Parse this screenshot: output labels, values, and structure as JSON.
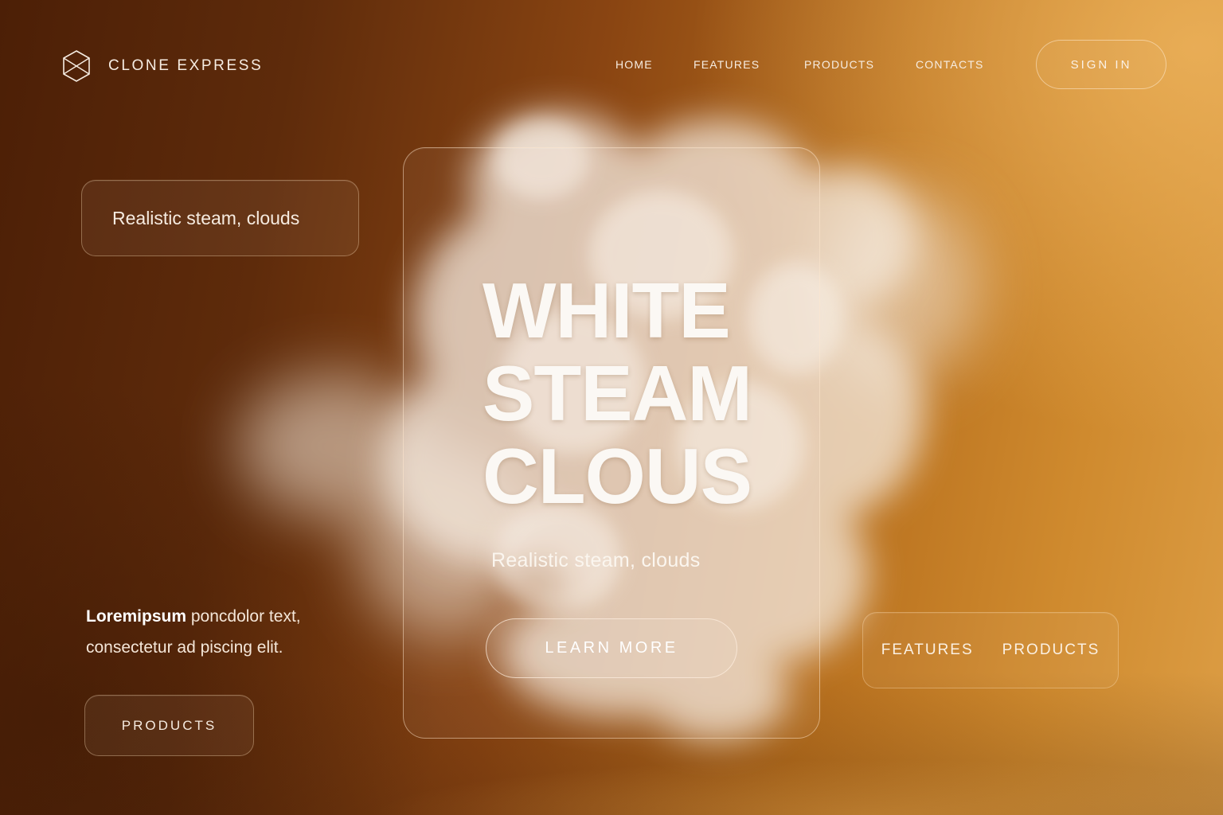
{
  "colors": {
    "background_dark": "#4c1f06",
    "background_mid": "#8a4512",
    "background_light": "#dc9d44",
    "text": "#ffffff"
  },
  "brand": {
    "name": "CLONE EXPRESS",
    "logo_icon": "hexagon-cube-icon"
  },
  "nav": {
    "items": [
      {
        "label": "HOME"
      },
      {
        "label": "FEATURES"
      },
      {
        "label": "PRODUCTS"
      },
      {
        "label": "CONTACTS"
      }
    ],
    "sign_in_label": "SIGN IN"
  },
  "tag_top": {
    "label": "Realistic steam, clouds"
  },
  "hero": {
    "title_lines": [
      "WHITE",
      "STEAM",
      "CLOUS"
    ],
    "subtitle": "Realistic steam, clouds",
    "cta_label": "LEARN MORE"
  },
  "intro": {
    "bold": "Loremipsum",
    "line1_rest": " poncdolor text,",
    "line2": "consectetur ad piscing elit."
  },
  "products_button_label": "PRODUCTS",
  "quick_nav": {
    "items": [
      "FEATURES",
      "PRODUCTS"
    ]
  }
}
